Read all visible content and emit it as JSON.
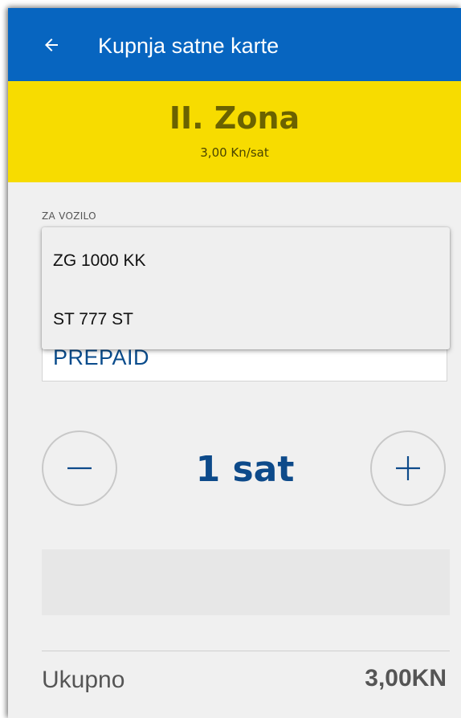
{
  "appbar": {
    "title": "Kupnja satne karte",
    "back_icon": "arrow-left-icon"
  },
  "zone": {
    "name": "II. Zona",
    "rate": "3,00 Kn/sat"
  },
  "vehicle": {
    "label": "ZA VOZILO",
    "selected_value": "PREPAID",
    "options": [
      "ZG 1000 KK",
      "ST 777 ST"
    ]
  },
  "duration": {
    "value": "1 sat",
    "decrease_icon": "minus-icon",
    "increase_icon": "plus-icon"
  },
  "total": {
    "label": "Ukupno",
    "value": "3,00KN"
  },
  "colors": {
    "appbar": "#0765c0",
    "zone_banner": "#f7dc00",
    "accent_text": "#0d4a8a"
  }
}
